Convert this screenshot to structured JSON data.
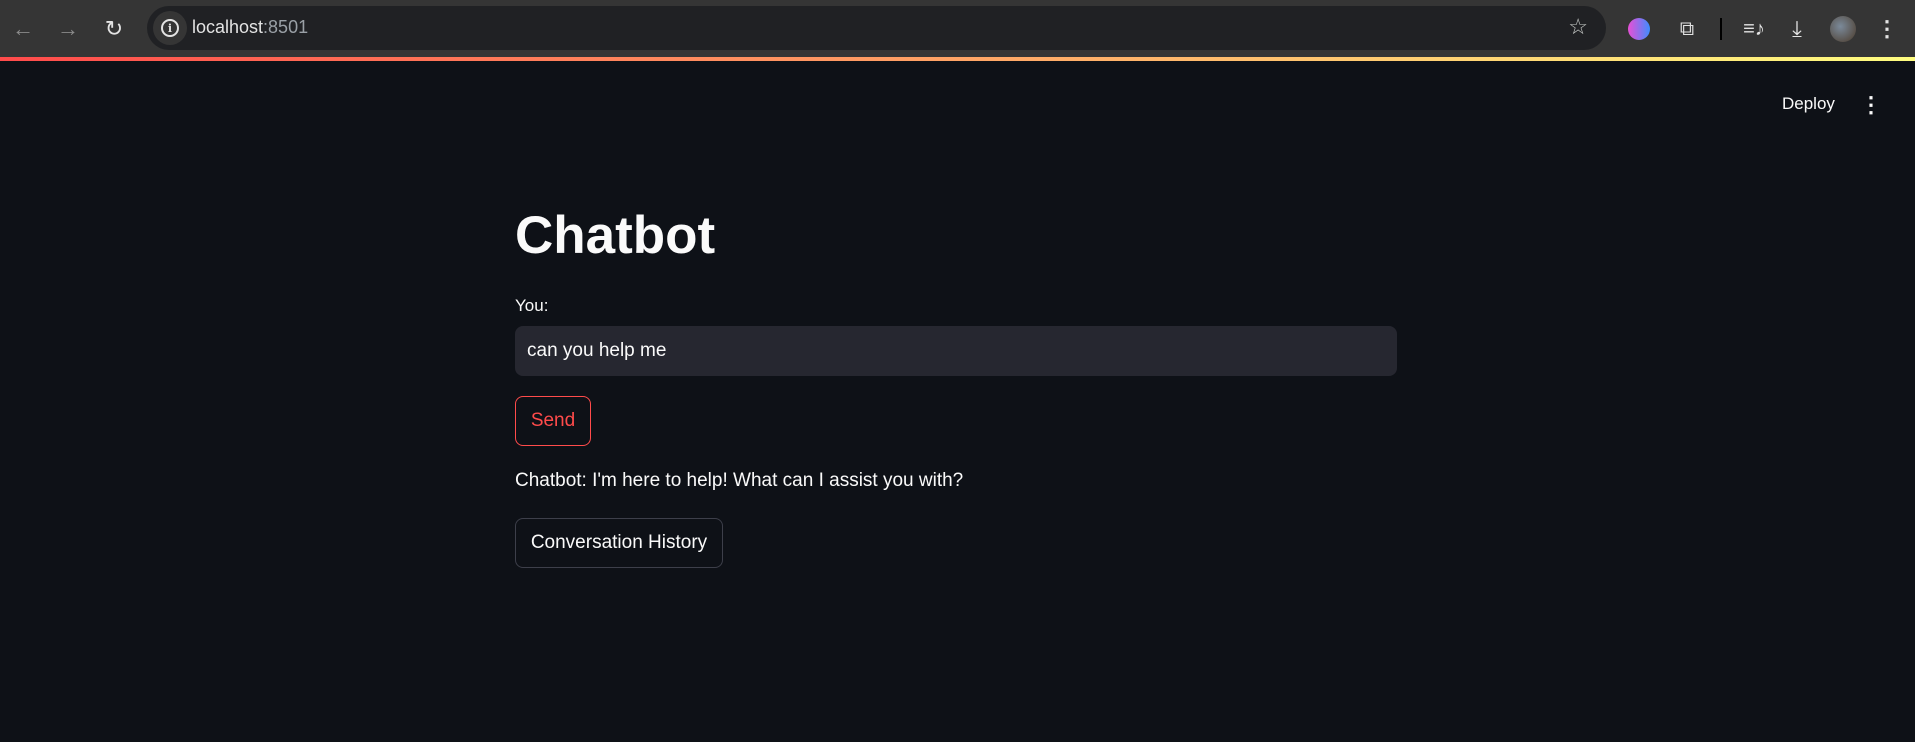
{
  "browser": {
    "url_host": "localhost",
    "url_port": ":8501",
    "icons": [
      "back-icon",
      "forward-icon",
      "reload-icon",
      "info-icon",
      "star-icon",
      "brain-extension-icon",
      "extensions-puzzle-icon",
      "media-queue-icon",
      "download-icon",
      "profile-avatar",
      "browser-menu-icon"
    ]
  },
  "header": {
    "deploy_label": "Deploy"
  },
  "main": {
    "title": "Chatbot",
    "input_label": "You:",
    "input_value": "can you help me",
    "send_label": "Send",
    "reply": "Chatbot: I'm here to help! What can I assist you with?",
    "history_label": "Conversation History"
  },
  "colors": {
    "background": "#0e1117",
    "accent": "#ff4b4b",
    "input_bg": "#262730"
  }
}
